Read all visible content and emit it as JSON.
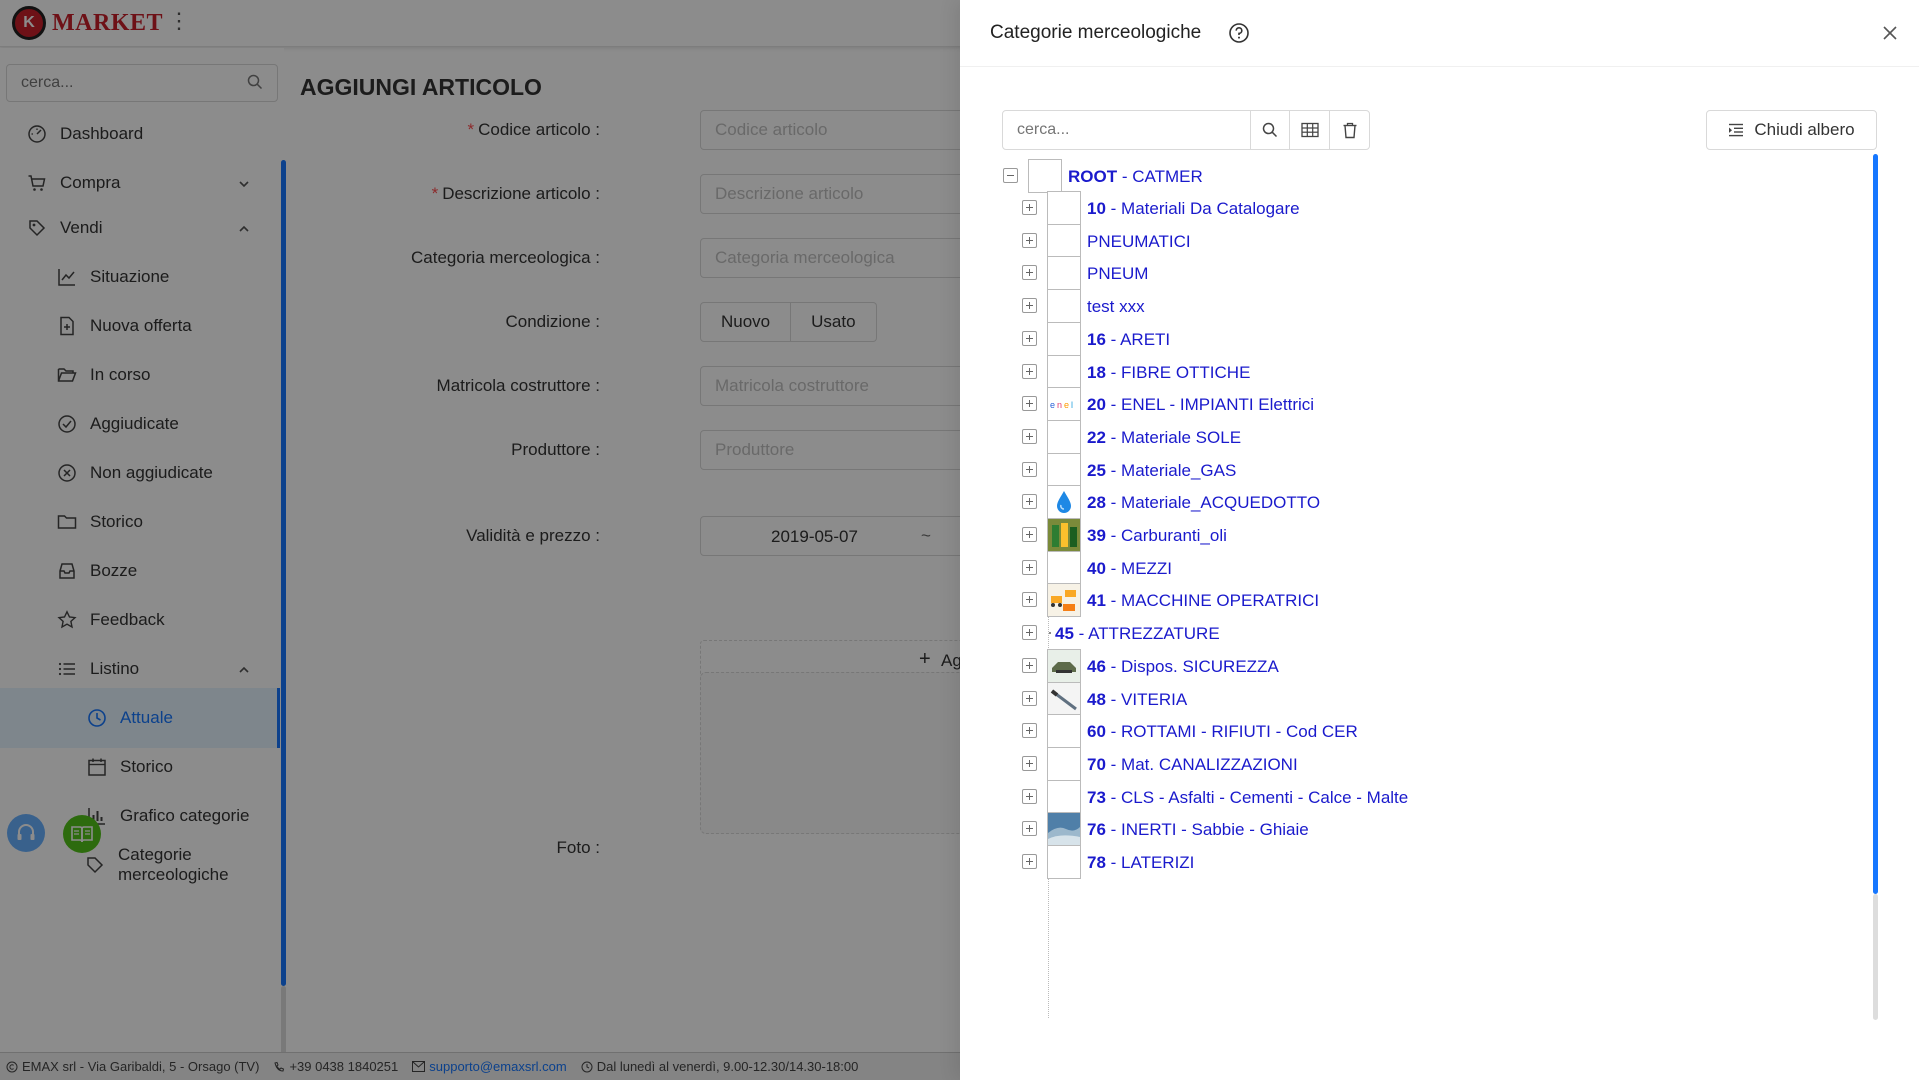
{
  "app": {
    "logo_text": "MARKET",
    "logo_mark": "K",
    "sidebar_search_placeholder": "cerca..."
  },
  "menu": [
    {
      "label": "Dashboard",
      "icon": "dashboard-icon",
      "level": 1
    },
    {
      "label": "Compra",
      "icon": "cart-icon",
      "level": 1,
      "chevron": "down"
    },
    {
      "label": "Vendi",
      "icon": "tag-icon",
      "level": 1,
      "chevron": "up"
    },
    {
      "label": "Situazione",
      "icon": "line-chart-icon",
      "level": 2
    },
    {
      "label": "Nuova offerta",
      "icon": "file-add-icon",
      "level": 2
    },
    {
      "label": "In corso",
      "icon": "folder-open-icon",
      "level": 2
    },
    {
      "label": "Aggiudicate",
      "icon": "check-circle-icon",
      "level": 2
    },
    {
      "label": "Non aggiudicate",
      "icon": "close-circle-icon",
      "level": 2
    },
    {
      "label": "Storico",
      "icon": "folder-icon",
      "level": 2
    },
    {
      "label": "Bozze",
      "icon": "inbox-icon",
      "level": 2
    },
    {
      "label": "Feedback",
      "icon": "star-icon",
      "level": 2
    },
    {
      "label": "Listino",
      "icon": "list-icon",
      "level": 2,
      "chevron": "up"
    },
    {
      "label": "Attuale",
      "icon": "clock-icon",
      "level": 3,
      "active": true
    },
    {
      "label": "Storico",
      "icon": "calendar-icon",
      "level": 3
    },
    {
      "label": "Grafico categorie",
      "icon": "bar-chart-icon",
      "level": 3
    },
    {
      "label": "Categorie merceologiche",
      "icon": "tags-icon",
      "level": 3
    }
  ],
  "form": {
    "title": "AGGIUNGI ARTICOLO",
    "codice_label": "Codice articolo",
    "codice_placeholder": "Codice articolo",
    "descrizione_label": "Descrizione articolo",
    "descrizione_placeholder": "Descrizione articolo",
    "categoria_label": "Categoria merceologica",
    "categoria_placeholder": "Categoria merceologica",
    "condizione_label": "Condizione",
    "condizione_nuovo": "Nuovo",
    "condizione_usato": "Usato",
    "matricola_label": "Matricola costruttore",
    "matricola_placeholder": "Matricola costruttore",
    "produttore_label": "Produttore",
    "produttore_placeholder": "Produttore",
    "validita_label": "Validità e prezzo",
    "validita_start": "2019-05-07",
    "validita_sep": "~",
    "add_button_text": "Ag",
    "foto_label": "Foto"
  },
  "footer": {
    "company": "EMAX srl - Via Garibaldi, 5 - Orsago (TV)",
    "phone": "+39 0438 1840251",
    "email": "supporto@emaxsrl.com",
    "hours": "Dal lunedì al venerdì, 9.00-12.30/14.30-18:00"
  },
  "drawer": {
    "title": "Categorie merceologiche",
    "search_placeholder": "cerca...",
    "close_tree_label": "Chiudi albero",
    "root": {
      "code": "ROOT",
      "name": "CATMER"
    },
    "nodes": [
      {
        "code": "10",
        "name": "Materiali Da Catalogare",
        "thumb": "empty"
      },
      {
        "code": "",
        "name": "PNEUMATICI",
        "thumb": "empty"
      },
      {
        "code": "",
        "name": "PNEUM",
        "thumb": "empty"
      },
      {
        "code": "",
        "name": "test xxx",
        "thumb": "empty"
      },
      {
        "code": "16",
        "name": "ARETI",
        "thumb": "empty"
      },
      {
        "code": "18",
        "name": "FIBRE OTTICHE",
        "thumb": "empty"
      },
      {
        "code": "20",
        "name": "ENEL - IMPIANTI Elettrici",
        "thumb": "enel"
      },
      {
        "code": "22",
        "name": "Materiale SOLE",
        "thumb": "empty"
      },
      {
        "code": "25",
        "name": "Materiale_GAS",
        "thumb": "empty"
      },
      {
        "code": "28",
        "name": "Materiale_ACQUEDOTTO",
        "thumb": "water"
      },
      {
        "code": "39",
        "name": "Carburanti_oli",
        "thumb": "fuel"
      },
      {
        "code": "40",
        "name": "MEZZI",
        "thumb": "empty"
      },
      {
        "code": "41",
        "name": "MACCHINE OPERATRICI",
        "thumb": "machines"
      },
      {
        "code": "45",
        "name": "ATTREZZATURE",
        "thumb": "none"
      },
      {
        "code": "46",
        "name": "Dispos. SICUREZZA",
        "thumb": "safety"
      },
      {
        "code": "48",
        "name": "VITERIA",
        "thumb": "screw"
      },
      {
        "code": "60",
        "name": "ROTTAMI - RIFIUTI - Cod CER",
        "thumb": "empty"
      },
      {
        "code": "70",
        "name": "Mat. CANALIZZAZIONI",
        "thumb": "empty"
      },
      {
        "code": "73",
        "name": "CLS - Asfalti - Cementi - Calce - Malte",
        "thumb": "empty"
      },
      {
        "code": "76",
        "name": "INERTI - Sabbie - Ghiaie",
        "thumb": "gravel"
      },
      {
        "code": "78",
        "name": "LATERIZI",
        "thumb": "empty"
      }
    ]
  },
  "colors": {
    "primary": "#1677ff",
    "brand_red": "#c8202a",
    "tree_text": "#1a1acc",
    "support_fab": "#69b1ff",
    "manual_fab": "#52c41a"
  }
}
